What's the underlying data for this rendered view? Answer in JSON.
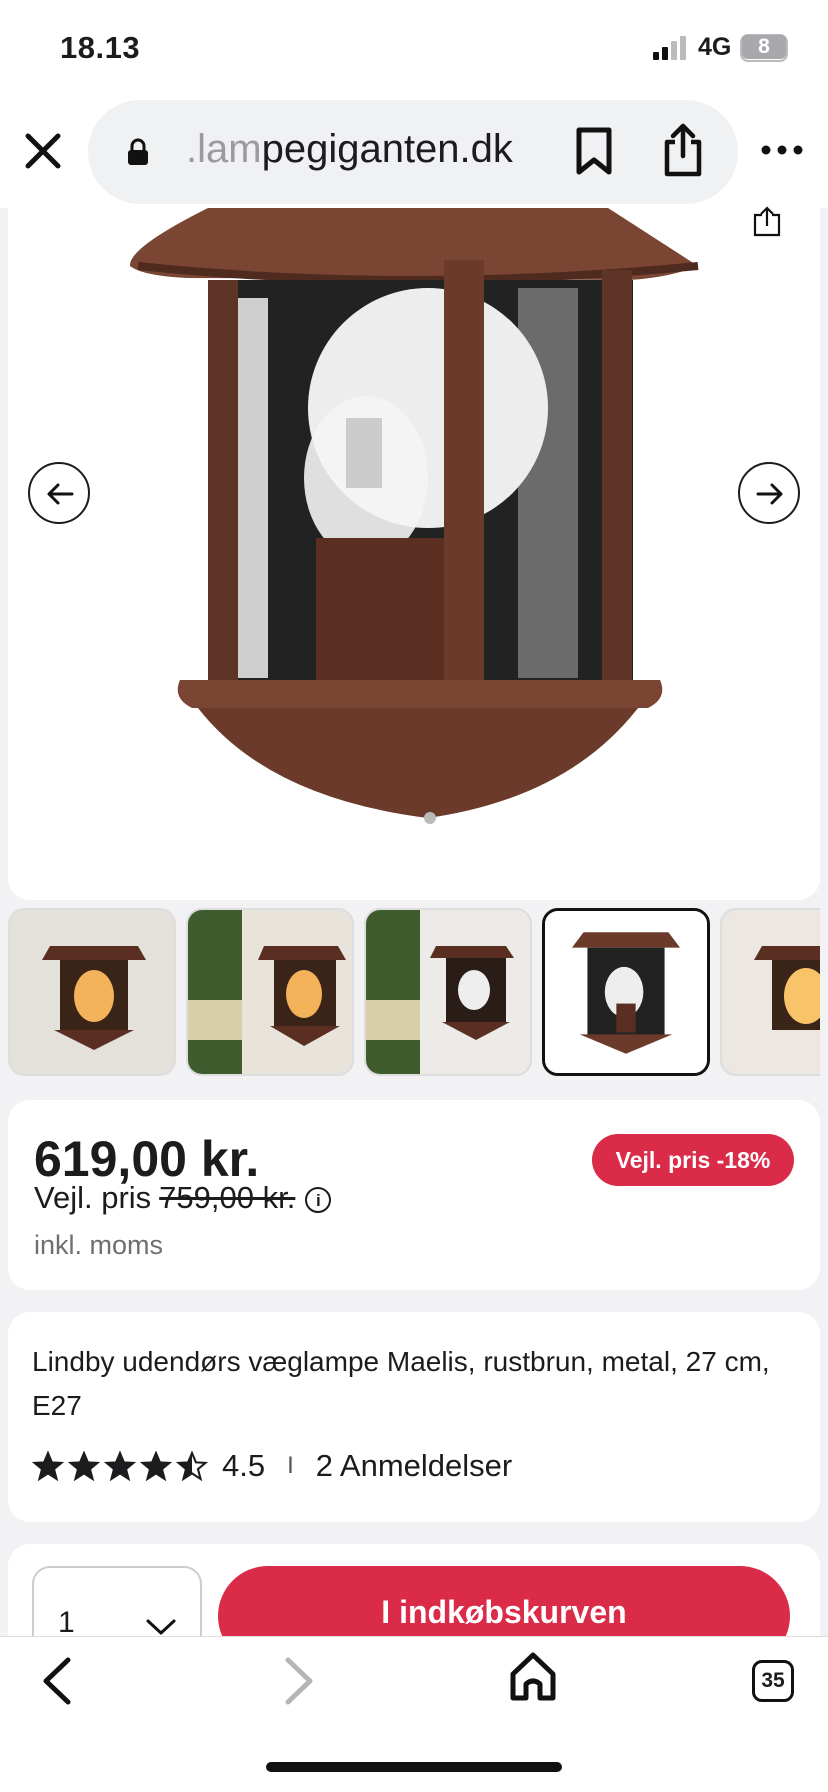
{
  "status_bar": {
    "time": "18.13",
    "network": "4G",
    "battery": "8"
  },
  "browser": {
    "url_faded": ".lam",
    "url_main": "pegiganten.dk",
    "tabs_count": "35"
  },
  "icons": {
    "close": "close-icon",
    "lock": "lock-icon",
    "bookmark": "bookmark-icon",
    "share": "share-icon",
    "more": "more-icon",
    "prev": "arrow-left-icon",
    "next": "arrow-right-icon",
    "back": "chevron-left-icon",
    "forward": "chevron-right-icon",
    "home": "home-icon",
    "tabs": "tabs-icon"
  },
  "gallery": {
    "thumbnail_count": 5,
    "selected_index": 3
  },
  "product": {
    "price": "619,00 kr.",
    "badge": "Vejl. pris -18%",
    "suggested_label": "Vejl. pris",
    "suggested_price": "759,00 kr.",
    "info_glyph": "i",
    "tax_note": "inkl. moms",
    "title": "Lindby udendørs væglampe Maelis, rustbrun, metal, 27 cm, E27",
    "rating_value": 4.5,
    "rating_text": "4.5",
    "separator": "I",
    "reviews": "2 Anmeldelser"
  },
  "cart": {
    "quantity": "1",
    "button_label": "I indkøbskurven"
  },
  "colors": {
    "accent": "#da2b49",
    "rust": "#6b3a2a",
    "text": "#1c1c1e"
  }
}
